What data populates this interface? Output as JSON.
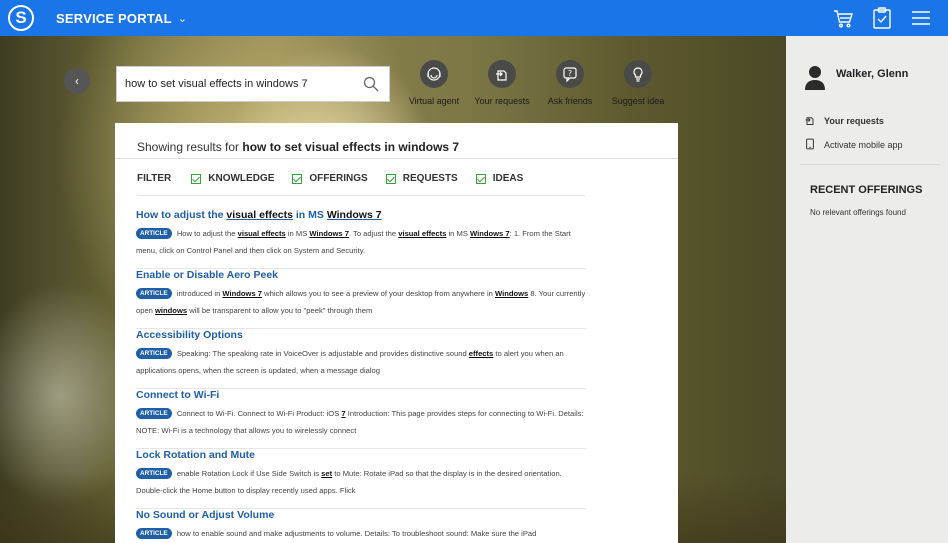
{
  "header": {
    "logo_letter": "S",
    "title": "SERVICE PORTAL",
    "title_chevron": "⌄",
    "icons": [
      "cart-icon",
      "clipboard-icon",
      "hamburger-menu-icon"
    ],
    "brand_color": "#1a75e8"
  },
  "search": {
    "back_label": "‹",
    "query": "how to set visual effects in windows 7"
  },
  "actions": [
    {
      "label": "Virtual agent",
      "icon": "virtual-agent-icon"
    },
    {
      "label": "Your requests",
      "icon": "requests-icon"
    },
    {
      "label": "Ask friends",
      "icon": "ask-friends-icon"
    },
    {
      "label": "Suggest idea",
      "icon": "lightbulb-icon"
    }
  ],
  "results_header": {
    "prefix": "Showing results for",
    "query": "how to set visual effects in windows 7"
  },
  "filter": {
    "label": "FILTER",
    "options": [
      "KNOWLEDGE",
      "OFFERINGS",
      "REQUESTS",
      "IDEAS"
    ]
  },
  "results": [
    {
      "title_parts": [
        "How to adjust the ",
        "visual effects",
        " in MS ",
        "Windows 7"
      ],
      "badge": "ARTICLE",
      "body_parts": [
        " How to adjust the ",
        "visual effects",
        " in MS ",
        "Windows 7",
        ". To adjust the ",
        "visual effects",
        " in MS ",
        "Windows 7",
        ": 1. From the Start menu, click on Control Panel and then click on System and Security."
      ]
    },
    {
      "title_parts": [
        "Enable or Disable Aero Peek"
      ],
      "badge": "ARTICLE",
      "body_parts": [
        " introduced in ",
        "Windows 7",
        " which allows you to see a preview of your desktop from anywhere in ",
        "Windows",
        " 8. Your currently open ",
        "windows",
        " will be transparent to allow you to \"peek\" through them"
      ]
    },
    {
      "title_parts": [
        "Accessibility Options"
      ],
      "badge": "ARTICLE",
      "body_parts": [
        " Speaking: The speaking rate in VoiceOver is adjustable and provides distinctive sound ",
        "effects",
        " to alert you when an applications opens, when the screen is updated, when a message dialog"
      ]
    },
    {
      "title_parts": [
        "Connect to Wi-Fi"
      ],
      "badge": "ARTICLE",
      "body_parts": [
        " Connect to Wi-Fi. Connect to Wi-Fi Product: iOS ",
        "7",
        " Introduction: This page provides steps for connecting to Wi-Fi. Details: NOTE: Wi-Fi is a technology that allows you to wirelessly connect"
      ]
    },
    {
      "title_parts": [
        "Lock Rotation and Mute"
      ],
      "badge": "ARTICLE",
      "body_parts": [
        " enable Rotation Lock if Use Side Switch is ",
        "set",
        " to Mute: Rotate iPad so that the display is in the desired orientation. Double-click the Home button to display recently used apps. Flick"
      ]
    },
    {
      "title_parts": [
        "No Sound or Adjust Volume"
      ],
      "badge": "ARTICLE",
      "body_parts": [
        " how to enable sound and make adjustments to volume. Details: To troubleshoot sound: Make sure the iPad"
      ]
    }
  ],
  "sidebar": {
    "user_name": "Walker, Glenn",
    "your_requests": "Your requests",
    "activate_mobile": "Activate mobile app",
    "recent_offerings_title": "RECENT OFFERINGS",
    "recent_offerings_empty": "No relevant offerings found"
  }
}
